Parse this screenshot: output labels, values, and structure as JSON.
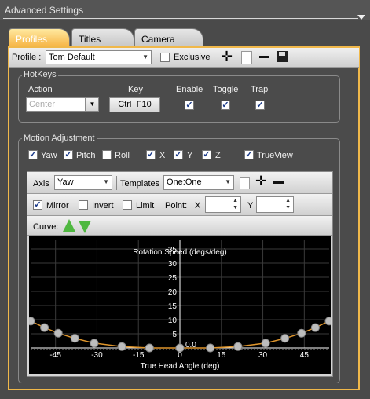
{
  "header": {
    "title": "Advanced Settings"
  },
  "tabs": [
    {
      "label": "Profiles",
      "active": true
    },
    {
      "label": "Titles",
      "active": false
    },
    {
      "label": "Camera",
      "active": false
    }
  ],
  "profile_bar": {
    "profile_label": "Profile :",
    "profile_value": "Tom Default",
    "exclusive_label": "Exclusive",
    "exclusive_checked": false
  },
  "hotkeys": {
    "title": "HotKeys",
    "col_action": "Action",
    "col_key": "Key",
    "col_enable": "Enable",
    "col_toggle": "Toggle",
    "col_trap": "Trap",
    "action_placeholder": "Center",
    "key_value": "Ctrl+F10",
    "enable": true,
    "toggle": true,
    "trap": true
  },
  "motion": {
    "title": "Motion Adjustment",
    "axes": [
      {
        "label": "Yaw",
        "checked": true
      },
      {
        "label": "Pitch",
        "checked": true
      },
      {
        "label": "Roll",
        "checked": false
      },
      {
        "label": "X",
        "checked": true
      },
      {
        "label": "Y",
        "checked": true
      },
      {
        "label": "Z",
        "checked": true
      },
      {
        "label": "TrueView",
        "checked": true
      }
    ]
  },
  "curve_editor": {
    "axis_label": "Axis",
    "axis_value": "Yaw",
    "templates_label": "Templates",
    "templates_value": "One:One",
    "mirror_label": "Mirror",
    "mirror_checked": true,
    "invert_label": "Invert",
    "invert_checked": false,
    "limit_label": "Limit",
    "limit_checked": false,
    "point_label": "Point:",
    "x_label": "X",
    "y_label": "Y",
    "curve_label": "Curve:"
  },
  "chart_data": {
    "type": "line",
    "title": "Rotation Speed (degs/deg)",
    "xlabel": "True Head Angle (deg)",
    "ylabel": "",
    "xlim": [
      -54,
      54
    ],
    "ylim": [
      0,
      35
    ],
    "x_ticks": [
      -45,
      -30,
      -15,
      0,
      15,
      30,
      45
    ],
    "y_ticks": [
      5,
      10,
      15,
      20,
      25,
      30,
      35
    ],
    "center_label": "0.0",
    "grid": true,
    "colors": {
      "curve": "#e0962c",
      "point": "#bdbdbd",
      "axis": "#ffffff",
      "grid": "#3a3a3a"
    },
    "points": [
      {
        "x": -54,
        "y": 9.5
      },
      {
        "x": -49,
        "y": 7.2
      },
      {
        "x": -44,
        "y": 5.2
      },
      {
        "x": -38,
        "y": 3.4
      },
      {
        "x": -31,
        "y": 1.7
      },
      {
        "x": -21,
        "y": 0.5
      },
      {
        "x": -11,
        "y": 0.0
      },
      {
        "x": 0,
        "y": 0.0
      },
      {
        "x": 11,
        "y": 0.0
      },
      {
        "x": 21,
        "y": 0.5
      },
      {
        "x": 31,
        "y": 1.7
      },
      {
        "x": 38,
        "y": 3.4
      },
      {
        "x": 44,
        "y": 5.2
      },
      {
        "x": 49,
        "y": 7.2
      },
      {
        "x": 54,
        "y": 9.5
      }
    ]
  }
}
